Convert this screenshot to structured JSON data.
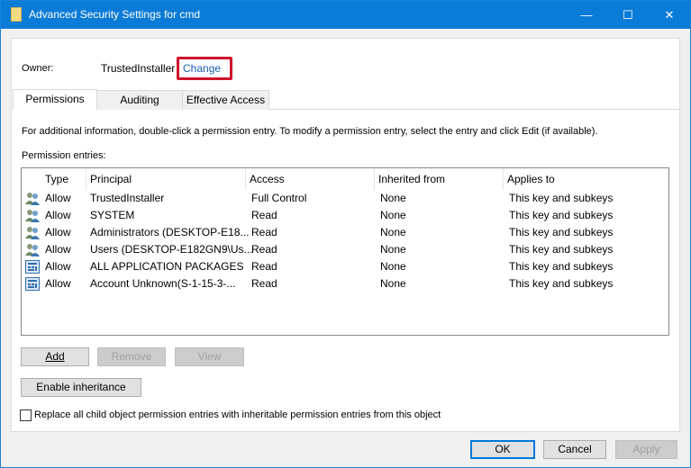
{
  "window": {
    "title": "Advanced Security Settings for cmd",
    "minimize": "—",
    "maximize": "☐",
    "close": "✕"
  },
  "owner": {
    "label": "Owner:",
    "value": "TrustedInstaller",
    "change_link": "Change"
  },
  "tabs": [
    {
      "label": "Permissions",
      "active": true
    },
    {
      "label": "Auditing"
    },
    {
      "label": "Effective Access"
    }
  ],
  "info_text": "For additional information, double-click a permission entry. To modify a permission entry, select the entry and click Edit (if available).",
  "entries_label": "Permission entries:",
  "columns": [
    "Type",
    "Principal",
    "Access",
    "Inherited from",
    "Applies to"
  ],
  "rows": [
    {
      "icon": "users-icon",
      "type": "Allow",
      "principal": "TrustedInstaller",
      "access": "Full Control",
      "inherited": "None",
      "applies": "This key and subkeys"
    },
    {
      "icon": "users-icon",
      "type": "Allow",
      "principal": "SYSTEM",
      "access": "Read",
      "inherited": "None",
      "applies": "This key and subkeys"
    },
    {
      "icon": "users-icon",
      "type": "Allow",
      "principal": "Administrators (DESKTOP-E18...",
      "access": "Read",
      "inherited": "None",
      "applies": "This key and subkeys"
    },
    {
      "icon": "users-icon",
      "type": "Allow",
      "principal": "Users (DESKTOP-E182GN9\\Us...",
      "access": "Read",
      "inherited": "None",
      "applies": "This key and subkeys"
    },
    {
      "icon": "app-package-icon",
      "type": "Allow",
      "principal": "ALL APPLICATION PACKAGES",
      "access": "Read",
      "inherited": "None",
      "applies": "This key and subkeys"
    },
    {
      "icon": "app-package-icon",
      "type": "Allow",
      "principal": "Account Unknown(S-1-15-3-...",
      "access": "Read",
      "inherited": "None",
      "applies": "This key and subkeys"
    }
  ],
  "buttons": {
    "add": "Add",
    "remove": "Remove",
    "view": "View",
    "enable_inheritance": "Enable inheritance",
    "ok": "OK",
    "cancel": "Cancel",
    "apply": "Apply"
  },
  "replace_checkbox": {
    "label": "Replace all child object permission entries with inheritable permission entries from this object",
    "checked": false
  },
  "colors": {
    "titlebar": "#0a7bd6",
    "highlight_box": "#d0112b",
    "link": "#1a5fb4"
  }
}
